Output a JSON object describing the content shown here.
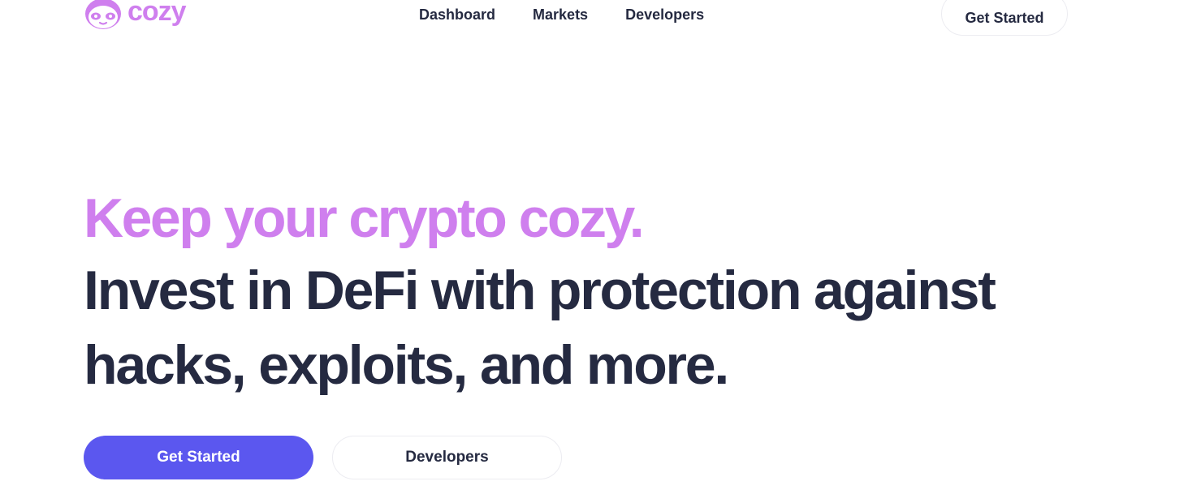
{
  "brand": {
    "name": "cozy",
    "logo_icon": "sloth-face-icon",
    "accent": "#cf7fee"
  },
  "nav": {
    "items": [
      {
        "label": "Dashboard"
      },
      {
        "label": "Markets"
      },
      {
        "label": "Developers"
      }
    ]
  },
  "header": {
    "cta_label": "Get Started"
  },
  "hero": {
    "tagline": "Keep your crypto cozy.",
    "headline_line1": "Invest in DeFi with protection against",
    "headline_line2": "hacks, exploits, and more.",
    "primary_label": "Get Started",
    "secondary_label": "Developers"
  },
  "colors": {
    "text": "#252a41",
    "accent": "#cf7fee",
    "primary_button": "#5b57ef"
  }
}
